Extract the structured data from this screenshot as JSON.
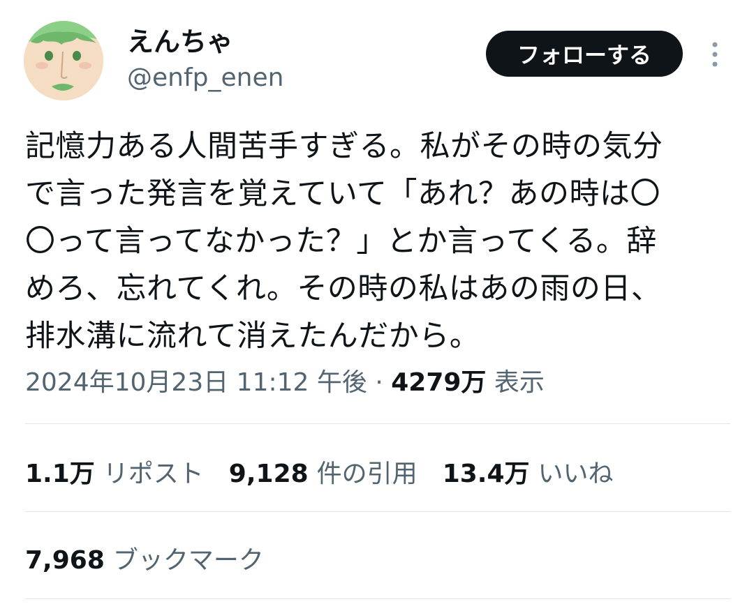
{
  "user": {
    "display_name": "えんちゃ",
    "handle": "@enfp_enen"
  },
  "actions": {
    "follow_label": "フォローする",
    "more_icon": "more-vertical-icon"
  },
  "tweet": {
    "lines": [
      "記憶力ある人間苦手すぎる。私がその時の気分",
      "で言った発言を覚えていて「あれ？あの時は〇",
      "〇って言ってなかった？」とか言ってくる。辞",
      "めろ、忘れてくれ。その時の私はあの雨の日、",
      "排水溝に流れて消えたんだから。"
    ]
  },
  "meta": {
    "timestamp": "2024年10月23日 11:12 午後",
    "separator": "·",
    "views_count": "4279万",
    "views_label": "表示"
  },
  "stats": {
    "reposts": {
      "count": "1.1万",
      "label": "リポスト"
    },
    "quotes": {
      "count": "9,128",
      "label": "件の引用"
    },
    "likes": {
      "count": "13.4万",
      "label": "いいね"
    },
    "bookmarks": {
      "count": "7,968",
      "label": "ブックマーク"
    }
  },
  "colors": {
    "text_primary": "#0f1419",
    "text_secondary": "#536471",
    "follow_bg": "#0f1419",
    "divider": "#e1e6ea",
    "avatar_hair": "#8ccf86",
    "avatar_skin": "#f5ddc3"
  }
}
